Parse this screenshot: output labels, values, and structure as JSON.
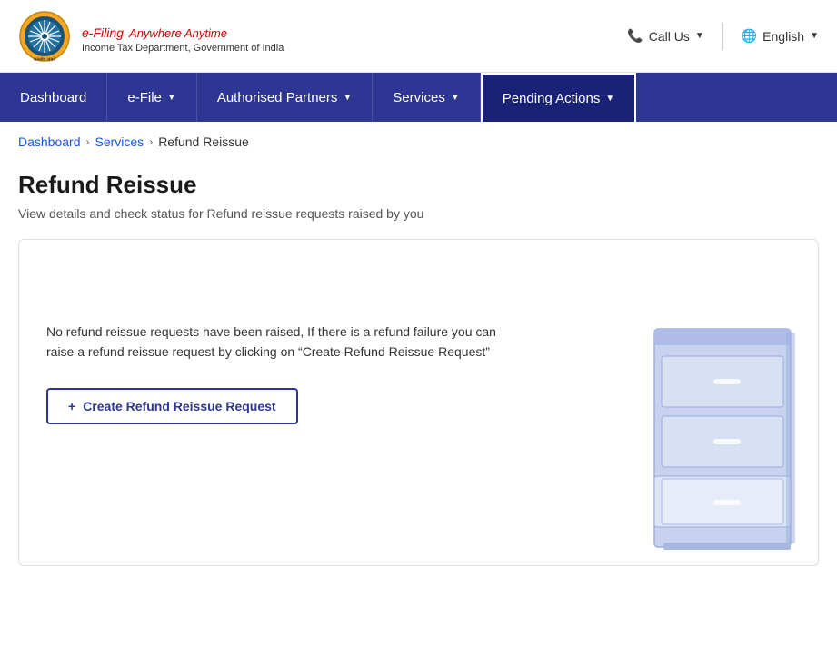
{
  "header": {
    "logo_title": "e-Filing",
    "logo_tagline": "Anywhere Anytime",
    "logo_subtitle": "Income Tax Department, Government of India",
    "call_us_label": "Call Us",
    "language_label": "English"
  },
  "navbar": {
    "items": [
      {
        "id": "dashboard",
        "label": "Dashboard",
        "has_dropdown": false,
        "active": false
      },
      {
        "id": "e-file",
        "label": "e-File",
        "has_dropdown": true,
        "active": false
      },
      {
        "id": "authorised-partners",
        "label": "Authorised Partners",
        "has_dropdown": true,
        "active": false
      },
      {
        "id": "services",
        "label": "Services",
        "has_dropdown": true,
        "active": false
      },
      {
        "id": "pending-actions",
        "label": "Pending Actions",
        "has_dropdown": true,
        "active": true
      }
    ]
  },
  "breadcrumb": {
    "links": [
      {
        "label": "Dashboard",
        "href": "#"
      },
      {
        "label": "Services",
        "href": "#"
      }
    ],
    "current": "Refund Reissue"
  },
  "page": {
    "title": "Refund Reissue",
    "subtitle": "View details and check status for Refund reissue requests raised by you",
    "card": {
      "message": "No refund reissue requests have been raised, If there is a refund failure you can raise a refund reissue request by clicking on “Create Refund Reissue Request”",
      "button_label": "Create Refund Reissue Request",
      "button_icon": "+"
    }
  }
}
